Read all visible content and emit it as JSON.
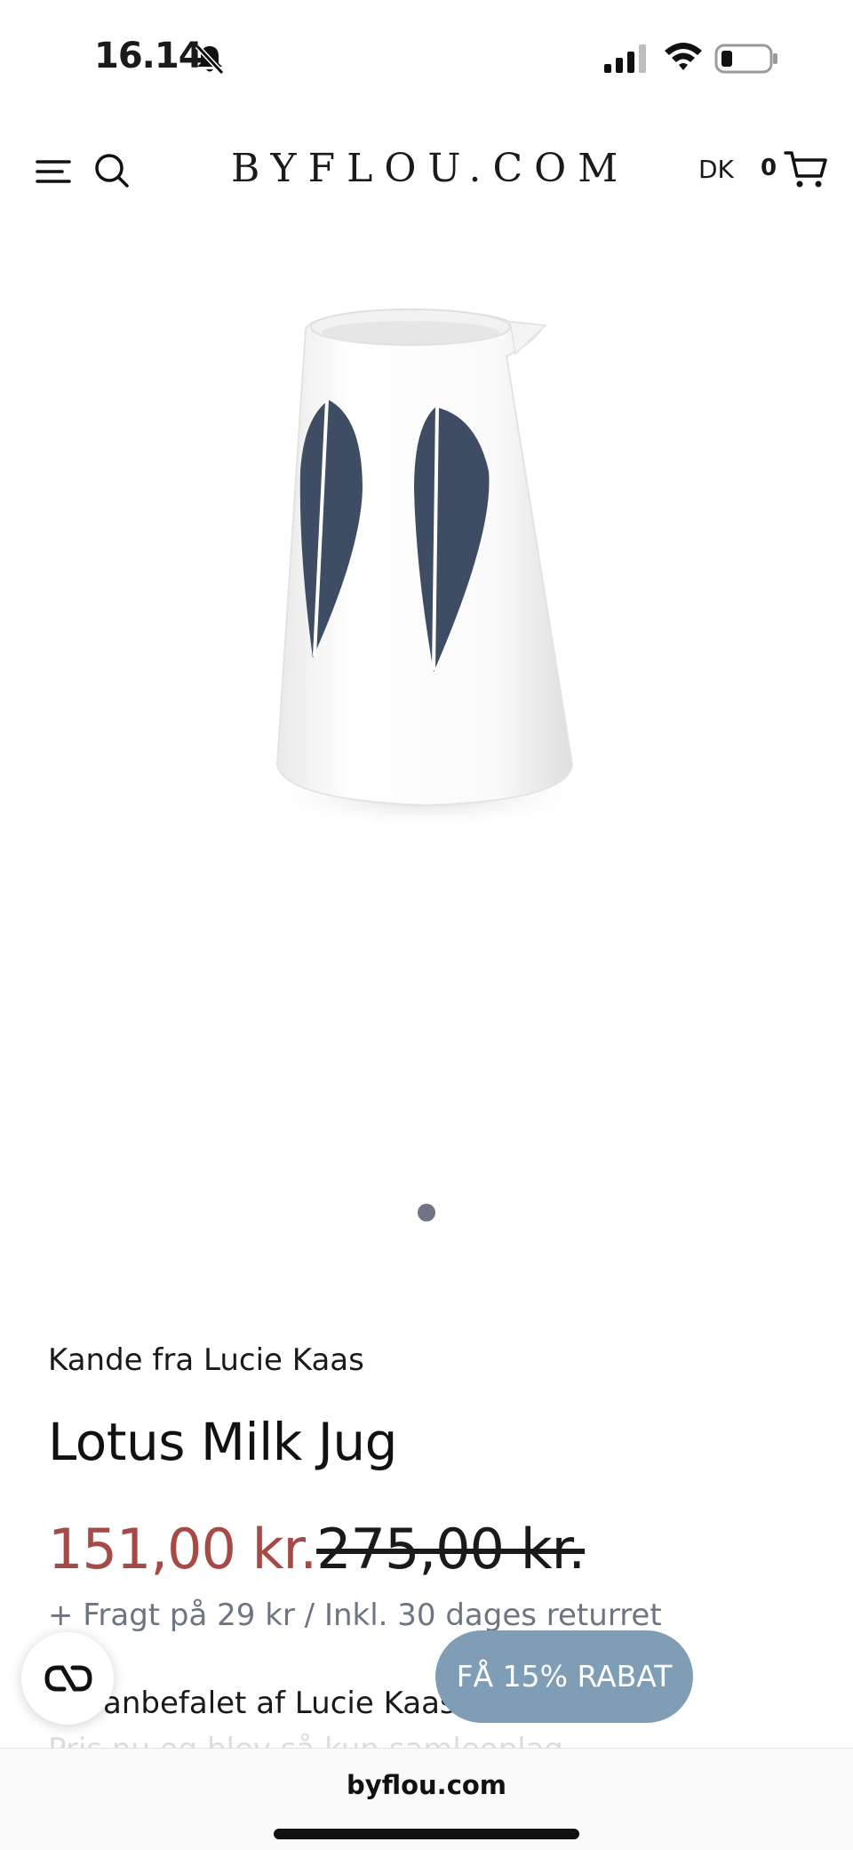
{
  "status": {
    "time": "16.14"
  },
  "header": {
    "brand": "BYFLOU.COM",
    "language": "DK",
    "cart_count": "0"
  },
  "product": {
    "subtitle": "Kande fra Lucie Kaas",
    "title": "Lotus Milk Jug",
    "price_sale": "151,00 kr.",
    "price_original": "275,00 kr.",
    "shipping": "+ Fragt på 29 kr / Inkl. 30 dages returret",
    "description_line1": "anbefalet af Lucie Kaas",
    "description_line2": "Pris nu og blev så kun samleoplag"
  },
  "floating": {
    "discount_label": "FÅ 15% RABAT"
  },
  "browser": {
    "url": "byflou.com"
  },
  "colors": {
    "sale_price": "#a54a47",
    "discount_button": "#7f9db5",
    "carousel_dot": "#6d7585",
    "lotus_leaf": "#3e4d63"
  }
}
